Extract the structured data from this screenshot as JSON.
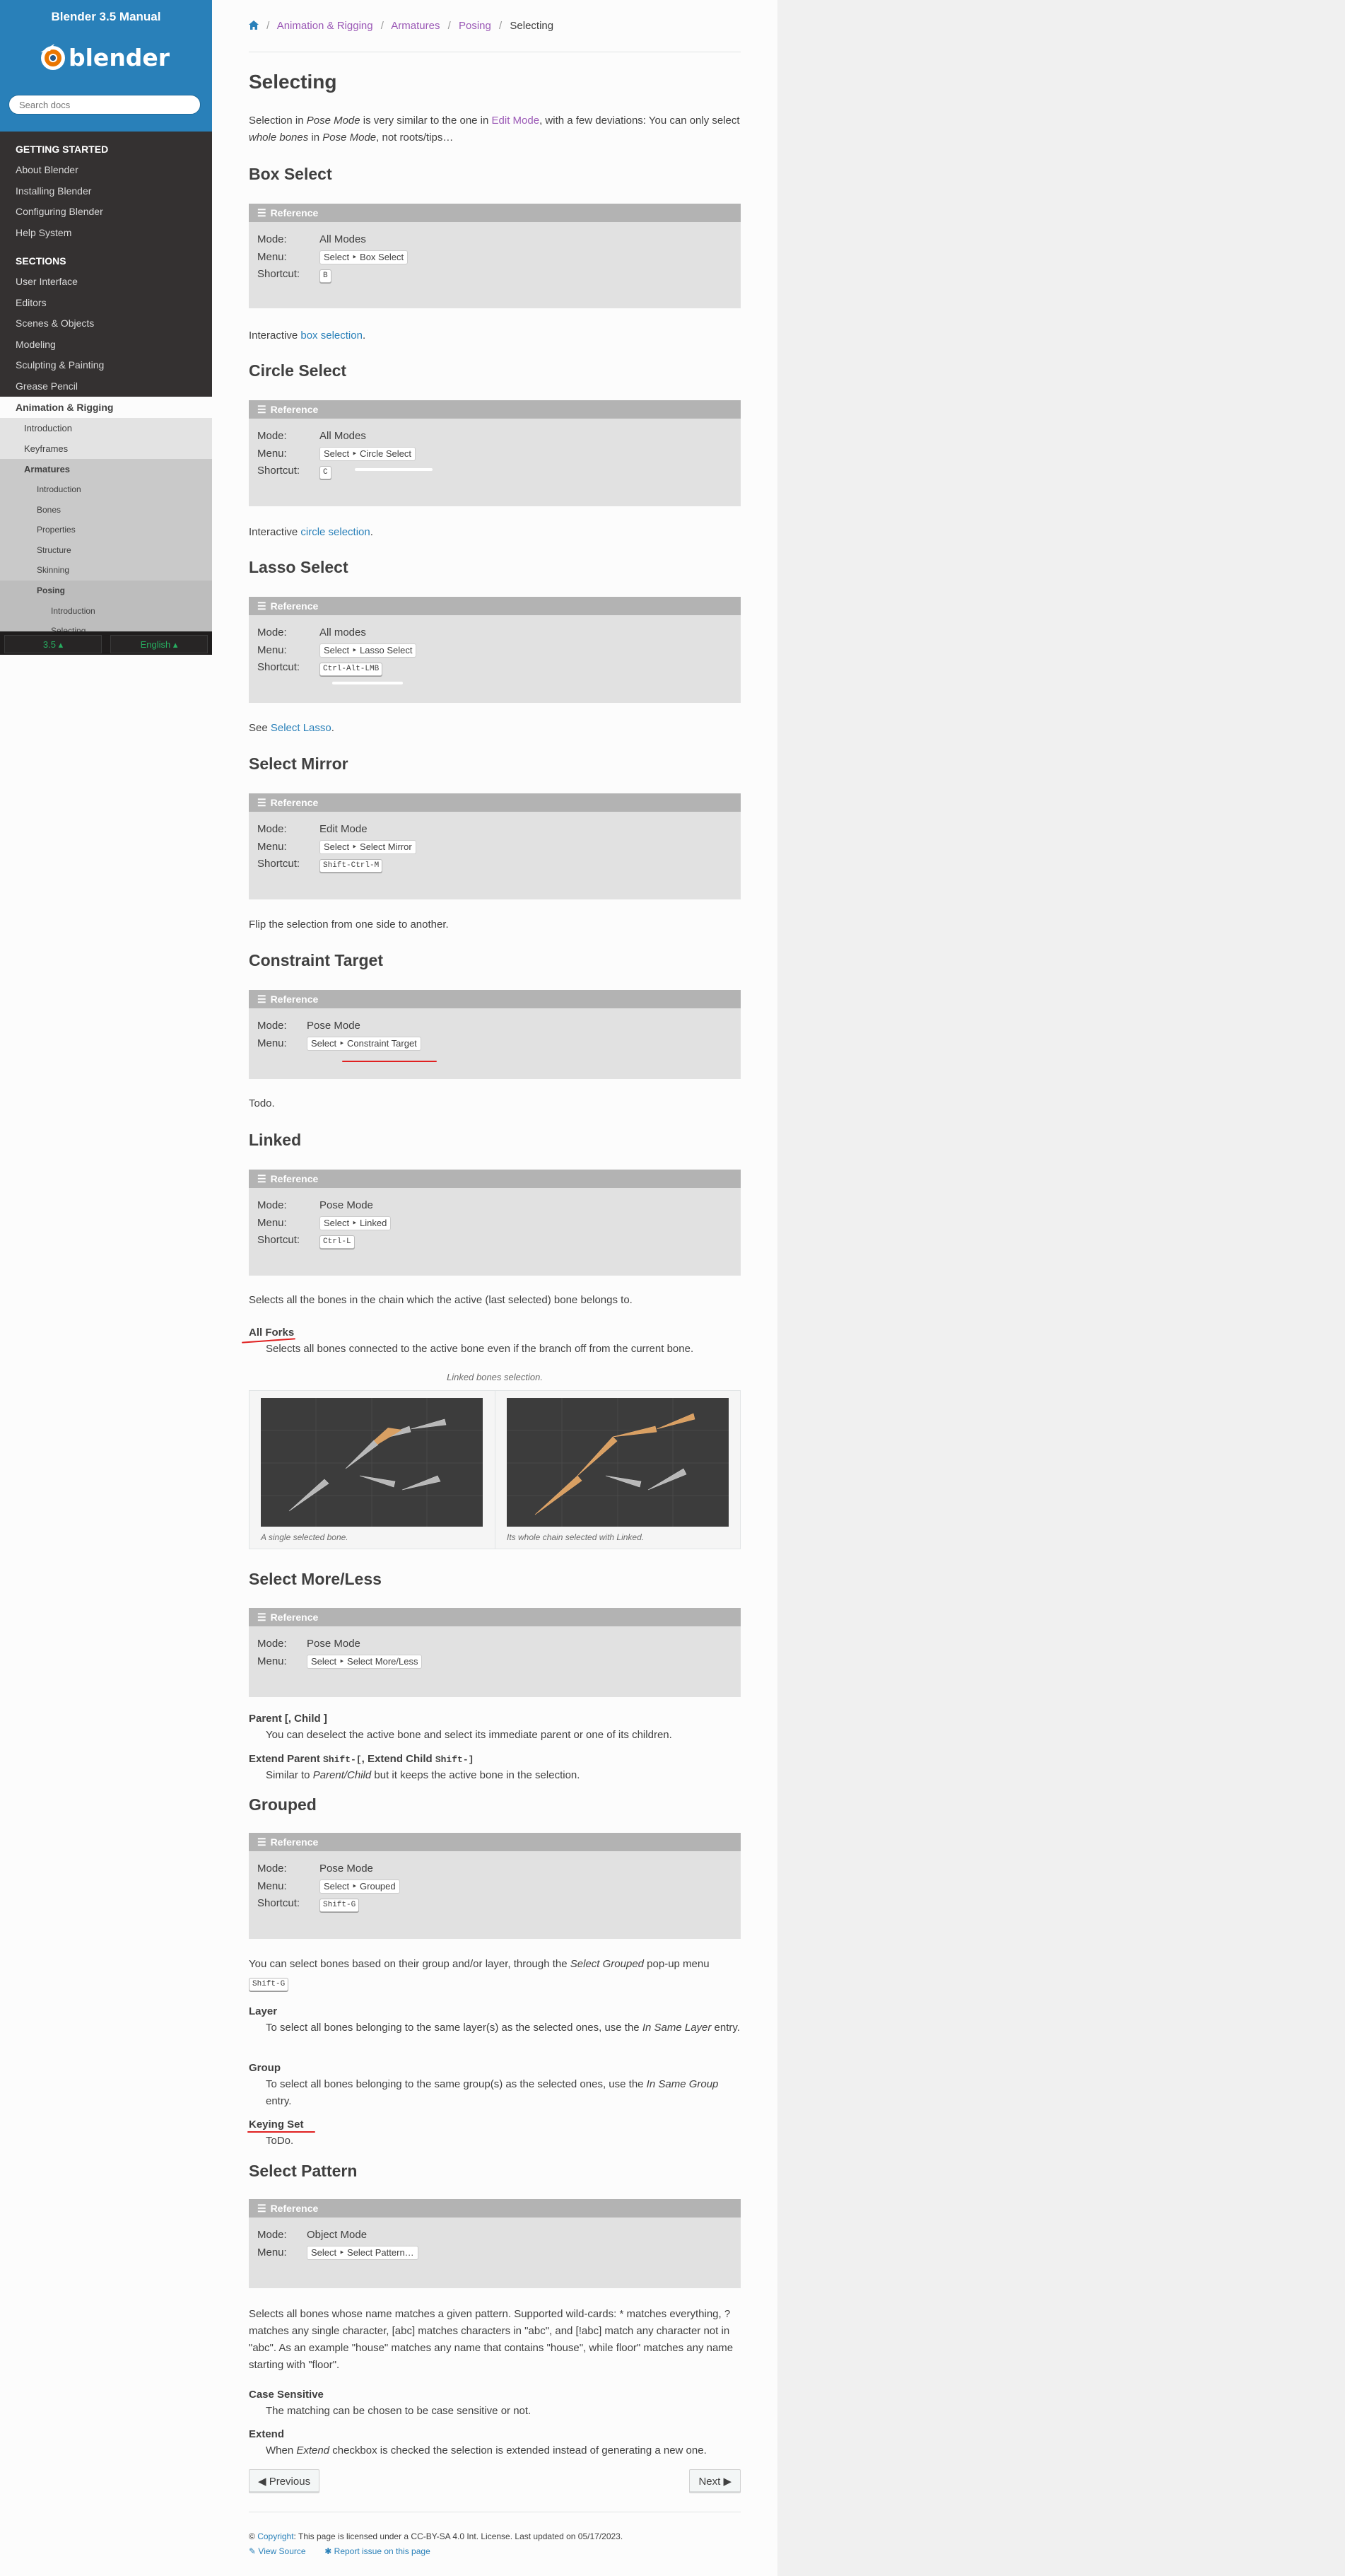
{
  "sidebar": {
    "title": "Blender 3.5 Manual",
    "logo_text": "blender",
    "search_placeholder": "Search docs",
    "caption_getting_started": "GETTING STARTED",
    "getting_started": [
      "About Blender",
      "Installing Blender",
      "Configuring Blender",
      "Help System"
    ],
    "caption_sections": "SECTIONS",
    "sections": [
      "User Interface",
      "Editors",
      "Scenes & Objects",
      "Modeling",
      "Sculpting & Painting",
      "Grease Pencil"
    ],
    "current": "Animation & Rigging",
    "anim_children": [
      "Introduction",
      "Keyframes",
      "Armatures"
    ],
    "armature_children": [
      "Introduction",
      "Bones",
      "Properties",
      "Structure",
      "Skinning",
      "Posing"
    ],
    "posing_children": [
      "Introduction",
      "Selecting"
    ],
    "version_label": "3.5",
    "language_label": "English"
  },
  "breadcrumb": [
    "Animation & Rigging",
    "Armatures",
    "Posing",
    "Selecting"
  ],
  "page_title": "Selecting",
  "intro": {
    "p1": "Selection in ",
    "em1": "Pose Mode",
    "p2": " is very similar to the one in ",
    "link": "Edit Mode",
    "p3": ", with a few deviations: You can only select ",
    "em2": "whole bones",
    "p4": " in ",
    "em3": "Pose Mode",
    "p5": ", not roots/tips…"
  },
  "labels": {
    "reference": "Reference",
    "mode": "Mode:",
    "menu": "Menu:",
    "shortcut": "Shortcut:"
  },
  "box_select": {
    "title": "Box Select",
    "mode": "All Modes",
    "menu": "Select ‣ Box Select",
    "shortcut": "B",
    "text": "Interactive ",
    "link": "box selection",
    "end": "."
  },
  "circle_select": {
    "title": "Circle Select",
    "mode": "All Modes",
    "menu": "Select ‣ Circle Select",
    "shortcut": "C",
    "text": "Interactive ",
    "link": "circle selection",
    "end": "."
  },
  "lasso_select": {
    "title": "Lasso Select",
    "mode": "All modes",
    "menu": "Select ‣ Lasso Select",
    "shortcut": "Ctrl-Alt-LMB",
    "text": "See ",
    "link": "Select Lasso",
    "end": "."
  },
  "select_mirror": {
    "title": "Select Mirror",
    "mode": "Edit Mode",
    "menu": "Select ‣ Select Mirror",
    "shortcut": "Shift-Ctrl-M",
    "text": "Flip the selection from one side to another."
  },
  "constraint_target": {
    "title": "Constraint Target",
    "mode": "Pose Mode",
    "menu": "Select ‣ Constraint Target",
    "text": "Todo."
  },
  "linked": {
    "title": "Linked",
    "mode": "Pose Mode",
    "menu": "Select ‣ Linked",
    "shortcut": "Ctrl-L",
    "text": "Selects all the bones in the chain which the active (last selected) bone belongs to.",
    "dt": "All Forks",
    "dd": "Selects all bones connected to the active bone even if the branch off from the current bone.",
    "figure_caption": "Linked bones selection.",
    "sub1": "A single selected bone.",
    "sub2": "Its whole chain selected with Linked."
  },
  "select_more_less": {
    "title": "Select More/Less",
    "mode": "Pose Mode",
    "menu": "Select ‣ Select More/Less",
    "dt1": "Parent [, Child ]",
    "dd1": "You can deselect the active bone and select its immediate parent or one of its children.",
    "dt2a": "Extend Parent ",
    "dt2k1": "Shift-[",
    "dt2b": ", Extend Child ",
    "dt2k2": "Shift-]",
    "dd2a": "Similar to ",
    "dd2em": "Parent/Child",
    "dd2b": " but it keeps the active bone in the selection."
  },
  "grouped": {
    "title": "Grouped",
    "mode": "Pose Mode",
    "menu": "Select ‣ Grouped",
    "shortcut": "Shift-G",
    "p1": "You can select bones based on their group and/or layer, through the ",
    "em": "Select Grouped",
    "p2": " pop-up menu",
    "key": "Shift-G",
    "dt1": "Layer",
    "dd1a": "To select all bones belonging to the same layer(s) as the selected ones, use the ",
    "dd1em": "In Same Layer",
    "dd1b": " entry.",
    "dt2": "Group",
    "dd2a": "To select all bones belonging to the same group(s) as the selected ones, use the ",
    "dd2em": "In Same Group",
    "dd2b": " entry.",
    "dt3": "Keying Set",
    "dd3": "ToDo."
  },
  "select_pattern": {
    "title": "Select Pattern",
    "mode": "Object Mode",
    "menu": "Select ‣ Select Pattern…",
    "text": "Selects all bones whose name matches a given pattern. Supported wild-cards: * matches everything, ? matches any single character, [abc] matches characters in \"abc\", and [!abc] match any character not in \"abc\". As an example \"house\" matches any name that contains \"house\", while floor\" matches any name starting with \"floor\".",
    "dt1": "Case Sensitive",
    "dd1": "The matching can be chosen to be case sensitive or not.",
    "dt2": "Extend",
    "dd2a": "When ",
    "dd2em": "Extend",
    "dd2b": " checkbox is checked the selection is extended instead of generating a new one."
  },
  "nav": {
    "previous": "Previous",
    "next": "Next"
  },
  "footer": {
    "copyright_link": "Copyright",
    "license": ": This page is licensed under a CC-BY-SA 4.0 Int. License. Last updated on 05/17/2023.",
    "view_source": "View Source",
    "report_issue": "Report issue on this page"
  },
  "colors": {
    "link": "#2980b9",
    "visited": "#9b59b6",
    "sidebar_bg": "#343131",
    "header_blue": "#2980b9",
    "annotation_red": "#e02020"
  }
}
